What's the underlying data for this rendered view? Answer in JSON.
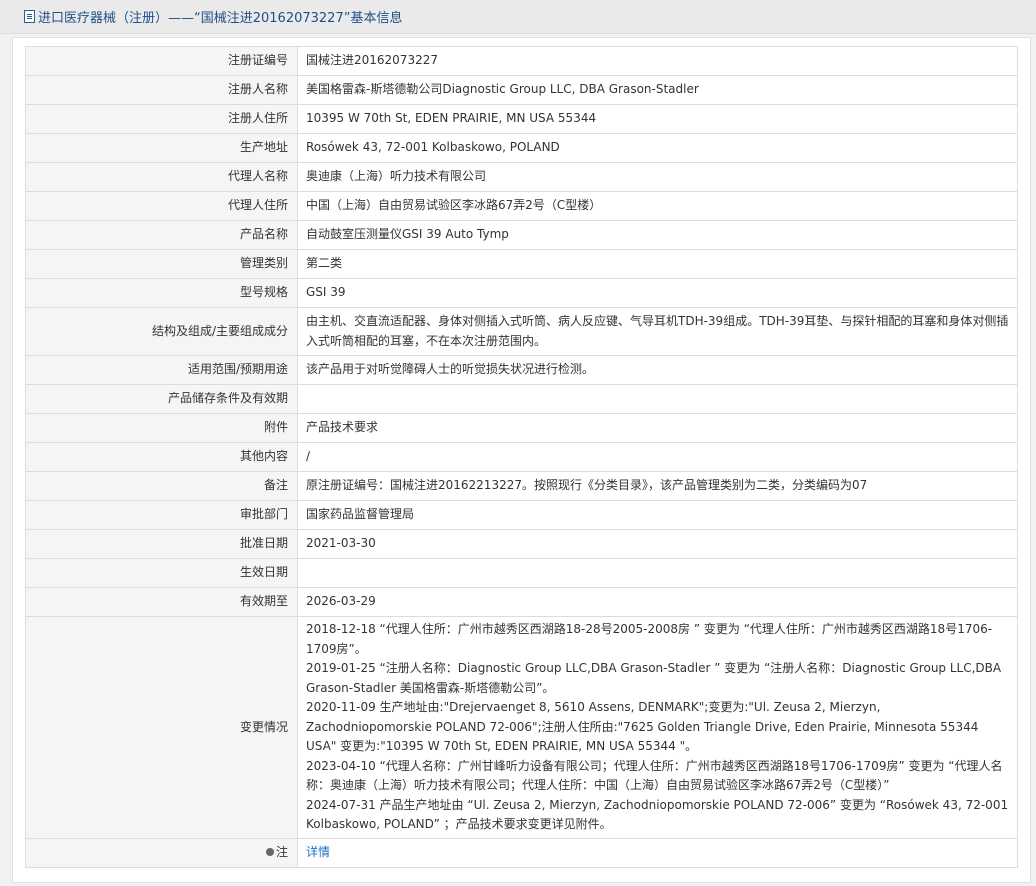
{
  "header": {
    "title": "进口医疗器械（注册）——“国械注进20162073227”基本信息"
  },
  "rows": [
    {
      "label": "注册证编号",
      "value": "国械注进20162073227"
    },
    {
      "label": "注册人名称",
      "value": "美国格雷森-斯塔德勒公司Diagnostic Group LLC, DBA Grason-Stadler"
    },
    {
      "label": "注册人住所",
      "value": "10395 W 70th St, EDEN PRAIRIE, MN USA 55344"
    },
    {
      "label": "生产地址",
      "value": "Rosówek 43, 72-001 Kolbaskowo, POLAND"
    },
    {
      "label": "代理人名称",
      "value": "奥迪康（上海）听力技术有限公司"
    },
    {
      "label": "代理人住所",
      "value": "中国（上海）自由贸易试验区李冰路67弄2号（C型楼）"
    },
    {
      "label": "产品名称",
      "value": "自动鼓室压测量仪GSI 39 Auto Tymp"
    },
    {
      "label": "管理类别",
      "value": "第二类"
    },
    {
      "label": "型号规格",
      "value": "GSI 39"
    },
    {
      "label": "结构及组成/主要组成成分",
      "value": "由主机、交直流适配器、身体对侧插入式听筒、病人反应键、气导耳机TDH-39组成。TDH-39耳垫、与探针相配的耳塞和身体对侧插入式听筒相配的耳塞，不在本次注册范围内。"
    },
    {
      "label": "适用范围/预期用途",
      "value": "该产品用于对听觉障碍人士的听觉损失状况进行检测。"
    },
    {
      "label": "产品储存条件及有效期",
      "value": ""
    },
    {
      "label": "附件",
      "value": "产品技术要求"
    },
    {
      "label": "其他内容",
      "value": "/"
    },
    {
      "label": "备注",
      "value": "原注册证编号：国械注进20162213227。按照现行《分类目录》，该产品管理类别为二类，分类编码为07"
    },
    {
      "label": "审批部门",
      "value": "国家药品监督管理局"
    },
    {
      "label": "批准日期",
      "value": "2021-03-30"
    },
    {
      "label": "生效日期",
      "value": ""
    },
    {
      "label": "有效期至",
      "value": "2026-03-29"
    }
  ],
  "changes": {
    "label": "变更情况",
    "entries": [
      "2018-12-18 “代理人住所：广州市越秀区西湖路18-28号2005-2008房 ” 变更为 “代理人住所：广州市越秀区西湖路18号1706-1709房”。",
      "2019-01-25 “注册人名称：Diagnostic Group LLC,DBA Grason-Stadler ” 变更为 “注册人名称：Diagnostic Group LLC,DBA Grason-Stadler 美国格雷森-斯塔德勒公司”。",
      "2020-11-09 生产地址由:\"Drejervaenget 8, 5610 Assens, DENMARK\";变更为:\"Ul. Zeusa 2, Mierzyn, Zachodniopomorskie POLAND 72-006\";注册人住所由:\"7625 Golden Triangle Drive, Eden Prairie, Minnesota 55344 USA\" 变更为:\"10395 W 70th St, EDEN PRAIRIE, MN USA 55344 \"。",
      "2023-04-10 “代理人名称：广州甘峰听力设备有限公司；代理人住所：广州市越秀区西湖路18号1706-1709房” 变更为 “代理人名称：奥迪康（上海）听力技术有限公司；代理人住所：中国（上海）自由贸易试验区李冰路67弄2号（C型楼）”",
      "2024-07-31 产品生产地址由 “Ul. Zeusa 2, Mierzyn, Zachodniopomorskie POLAND 72-006” 变更为 “Rosówek 43, 72-001 Kolbaskowo, POLAND” ；产品技术要求变更详见附件。"
    ]
  },
  "note": {
    "label": "注",
    "icon": "note-icon",
    "link_text": "详情"
  }
}
